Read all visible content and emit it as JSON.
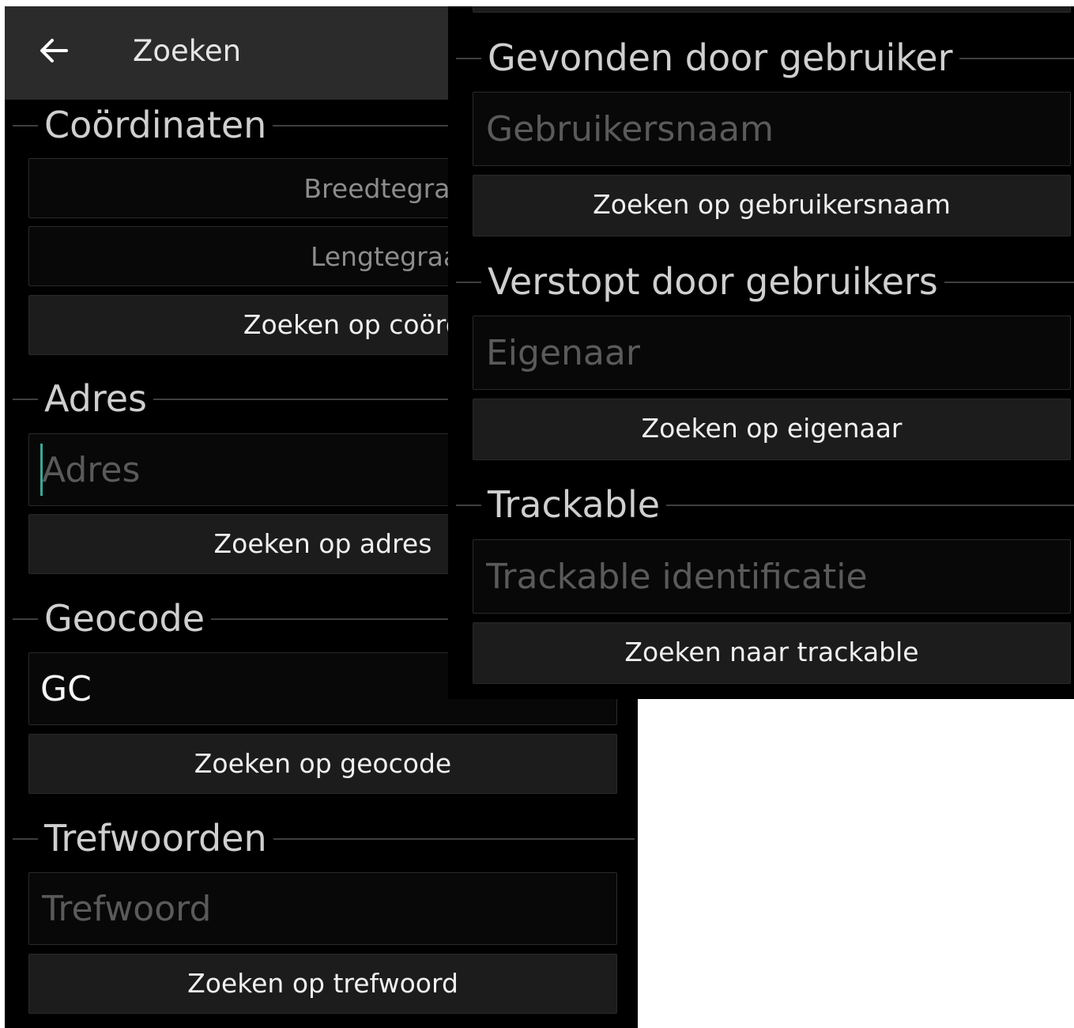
{
  "appbar": {
    "title": "Zoeken"
  },
  "coordinates": {
    "header": "Coördinaten",
    "latitude_placeholder": "Breedtegraad",
    "longitude_placeholder": "Lengtegraad",
    "button": "Zoeken op coördinaten"
  },
  "address": {
    "header": "Adres",
    "placeholder": "Adres",
    "button": "Zoeken op adres"
  },
  "geocode": {
    "header": "Geocode",
    "value": "GC",
    "button": "Zoeken op geocode"
  },
  "keywords": {
    "header": "Trefwoorden",
    "placeholder": "Trefwoord",
    "button": "Zoeken op trefwoord"
  },
  "found_by": {
    "header": "Gevonden door gebruiker",
    "placeholder": "Gebruikersnaam",
    "button": "Zoeken op gebruikersnaam"
  },
  "hidden_by": {
    "header": "Verstopt door gebruikers",
    "placeholder": "Eigenaar",
    "button": "Zoeken op eigenaar"
  },
  "trackable": {
    "header": "Trackable",
    "placeholder": "Trackable identificatie",
    "button": "Zoeken naar trackable"
  },
  "colors": {
    "background": "#000000",
    "appbar": "#2b2b2b",
    "button": "#1c1c1c",
    "caret": "#39a99b"
  }
}
